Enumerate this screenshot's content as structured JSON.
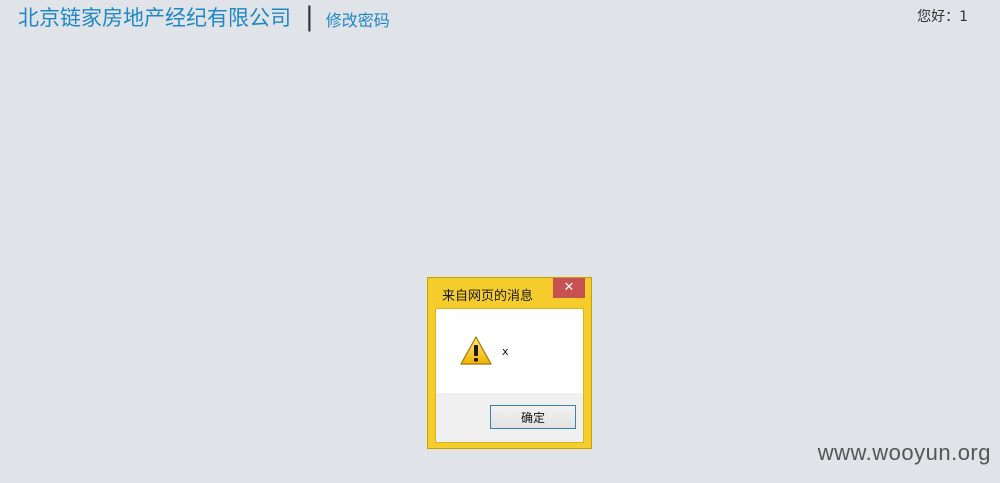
{
  "header": {
    "company_name": "北京链家房地产经纪有限公司",
    "divider": "|",
    "change_password": "修改密码",
    "greeting": "您好：1"
  },
  "dialog": {
    "title": "来自网页的消息",
    "close_glyph": "✕",
    "message": "x",
    "ok_label": "确定",
    "icon": "warning-icon"
  },
  "watermark": "www.wooyun.org",
  "colors": {
    "page_background": "#e0e3e8",
    "link_blue": "#1e88c6",
    "dialog_frame": "#f4cc2c",
    "close_button": "#c75050"
  }
}
